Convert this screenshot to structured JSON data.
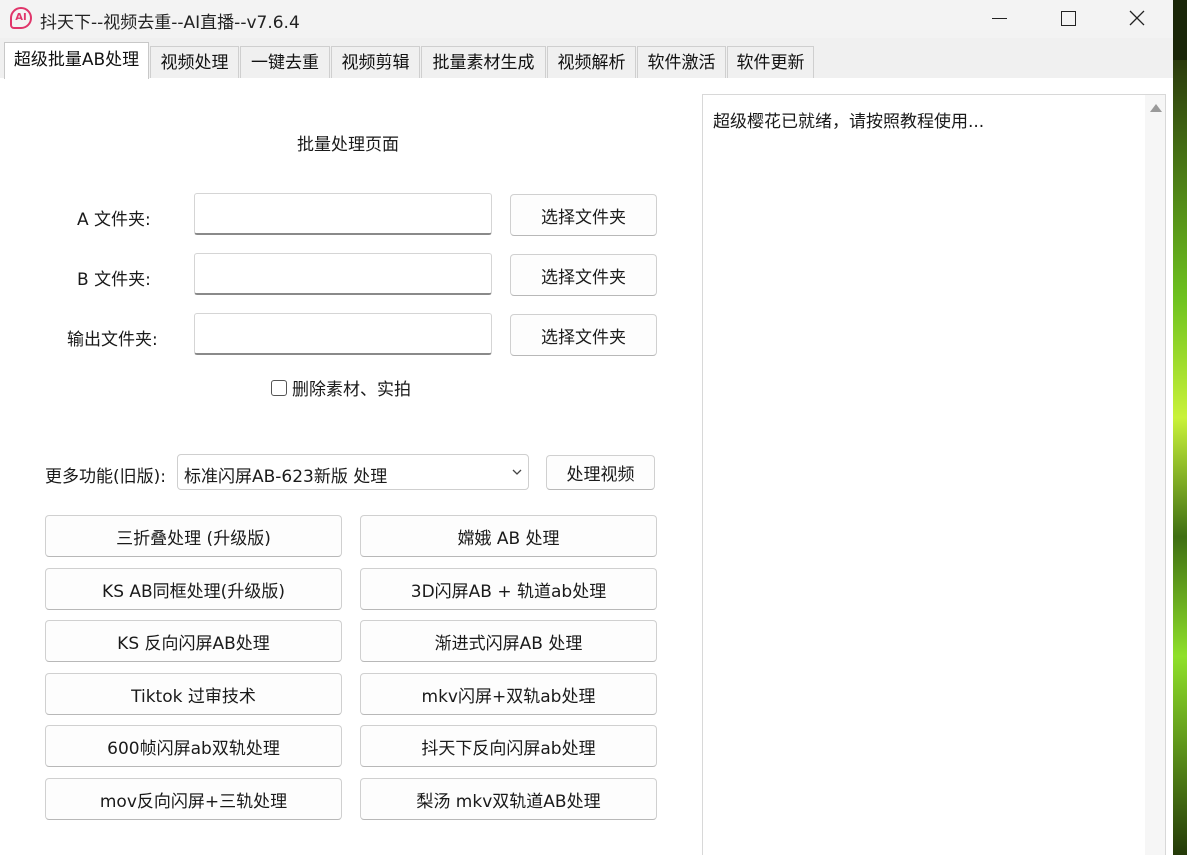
{
  "window": {
    "title": "抖天下--视频去重--AI直播--v7.6.4",
    "app_icon_text": "AI"
  },
  "tabs": [
    {
      "label": "超级批量AB处理",
      "active": true
    },
    {
      "label": "视频处理"
    },
    {
      "label": "一键去重"
    },
    {
      "label": "视频剪辑"
    },
    {
      "label": "批量素材生成"
    },
    {
      "label": "视频解析"
    },
    {
      "label": "软件激活"
    },
    {
      "label": "软件更新"
    }
  ],
  "main": {
    "heading": "批量处理页面",
    "folder_a": {
      "label": "A 文件夹:",
      "value": "",
      "button": "选择文件夹"
    },
    "folder_b": {
      "label": "B 文件夹:",
      "value": "",
      "button": "选择文件夹"
    },
    "folder_out": {
      "label": "输出文件夹:",
      "value": "",
      "button": "选择文件夹"
    },
    "delete_checkbox": {
      "label": "删除素材、实拍",
      "checked": false
    },
    "more_label": "更多功能(旧版):",
    "mode_select": {
      "value": "标准闪屏AB-623新版 处理"
    },
    "process_button": "处理视频",
    "action_buttons": [
      "三折叠处理 (升级版)",
      "嫦娥 AB 处理",
      "KS AB同框处理(升级版)",
      "3D闪屏AB + 轨道ab处理",
      "KS 反向闪屏AB处理",
      "渐进式闪屏AB 处理",
      "Tiktok 过审技术",
      "mkv闪屏+双轨ab处理",
      "600帧闪屏ab双轨处理",
      "抖天下反向闪屏ab处理",
      "mov反向闪屏+三轨处理",
      "梨汤 mkv双轨道AB处理"
    ]
  },
  "log": {
    "text": "超级樱花已就绪，请按照教程使用..."
  },
  "colors": {
    "icon_accent": "#e0356a",
    "desktop_accent": "#8fe02a"
  }
}
